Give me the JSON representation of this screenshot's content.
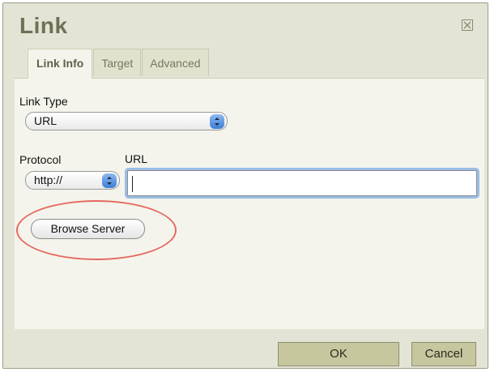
{
  "dialog": {
    "title": "Link",
    "tabs": [
      {
        "label": "Link Info",
        "active": true
      },
      {
        "label": "Target",
        "active": false
      },
      {
        "label": "Advanced",
        "active": false
      }
    ],
    "link_type": {
      "label": "Link Type",
      "value": "URL"
    },
    "protocol": {
      "label": "Protocol",
      "value": "http://"
    },
    "url": {
      "label": "URL",
      "value": ""
    },
    "browse_server_label": "Browse Server",
    "ok_label": "OK",
    "cancel_label": "Cancel"
  },
  "colors": {
    "dialog_bg": "#e4e4d6",
    "panel_bg": "#f4f4ec",
    "title": "#6f6f56",
    "button_bg": "#c7c79f",
    "focus_ring": "#9bbde8",
    "annotation_circle": "#e56a5f"
  },
  "icons": {
    "close": "close-icon",
    "select_arrows": "chevron-updown-icon"
  }
}
